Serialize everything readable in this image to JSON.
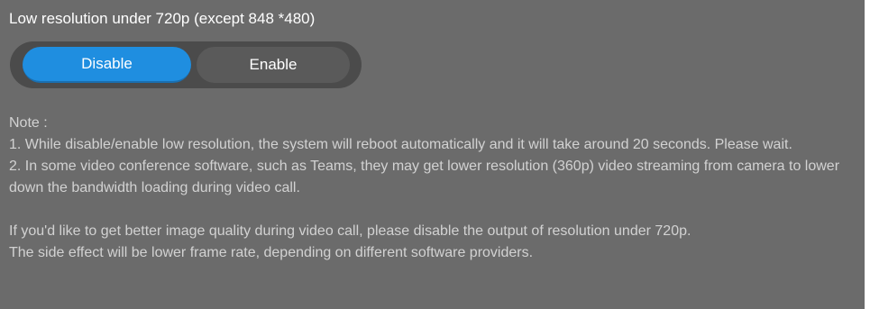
{
  "setting": {
    "title": "Low resolution under 720p (except 848 *480)"
  },
  "toggle": {
    "selected": "Disable",
    "disable_label": "Disable",
    "enable_label": "Enable",
    "colors": {
      "active": "#1f8ee0",
      "inactive": "#5a5a5a",
      "track": "#4b4b4b"
    }
  },
  "notes": {
    "heading": "Note :",
    "item1": "1. While disable/enable low resolution, the system will reboot automatically and it will take around 20 seconds. Please wait.",
    "item2": "2. In some video conference software, such as Teams, they may get lower resolution (360p) video streaming from camera to lower down the bandwidth loading during video call.",
    "para1": "If you'd like to get better image quality during video call, please disable the output of resolution under 720p.",
    "para2": "The side effect will be lower frame rate, depending on different software providers."
  }
}
